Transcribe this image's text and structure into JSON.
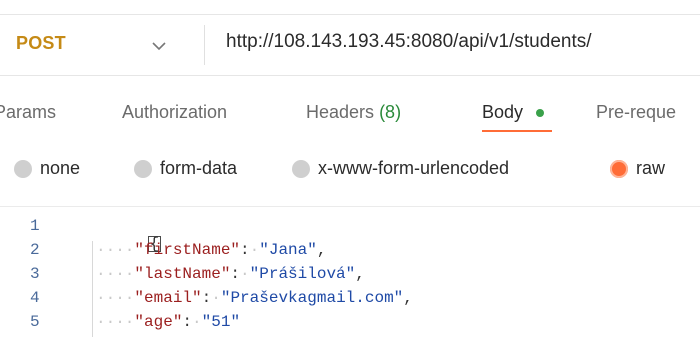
{
  "request": {
    "method": "POST",
    "url": "http://108.143.193.45:8080/api/v1/students/"
  },
  "tabs": {
    "params": "Params",
    "authorization": "Authorization",
    "headers_label": "Headers",
    "headers_count": "(8)",
    "body": "Body",
    "pre_request": "Pre-reque"
  },
  "body_types": {
    "none": "none",
    "form_data": "form-data",
    "urlencoded": "x-www-form-urlencoded",
    "raw": "raw",
    "selected": "raw"
  },
  "editor": {
    "line_numbers": [
      "1",
      "2",
      "3",
      "4",
      "5"
    ],
    "brace_open": "{",
    "lines": [
      {
        "key": "\"firstName\"",
        "value": "\"Jana\"",
        "end": ","
      },
      {
        "key": "\"lastName\"",
        "value": "\"Prášilová\"",
        "end": ","
      },
      {
        "key": "\"email\"",
        "value": "\"Praševkagmail.com\"",
        "end": ","
      },
      {
        "key": "\"age\"",
        "value": "\"51\"",
        "end": ""
      }
    ]
  },
  "colors": {
    "method": "#c58a16",
    "accent": "#ff6c37",
    "count_green": "#2a8a3a"
  }
}
